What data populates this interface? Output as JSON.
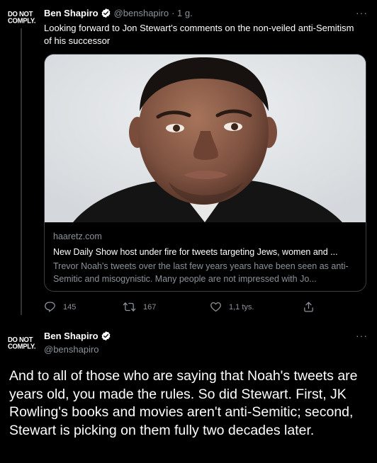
{
  "tweet1": {
    "avatar_text": [
      "DO NOT",
      "COMPLY."
    ],
    "author_name": "Ben Shapiro",
    "handle": "@benshapiro",
    "time": "· 1 g.",
    "more": "···",
    "text": "Looking forward to Jon Stewart's comments on the non-veiled anti-Semitism of his successor",
    "card": {
      "domain": "haaretz.com",
      "title": "New Daily Show host under fire for tweets targeting Jews, women and ...",
      "description": "Trevor Noah's tweets over the last few years years have been seen as anti-Semitic and misogynistic. Many people are not impressed with Jo..."
    },
    "actions": {
      "replies": "145",
      "retweets": "167",
      "likes": "1,1 tys."
    }
  },
  "tweet2": {
    "avatar_text": [
      "DO NOT",
      "COMPLY."
    ],
    "author_name": "Ben Shapiro",
    "handle": "@benshapiro",
    "more": "···",
    "text": "And to all of those who are saying that Noah's tweets are years old, you made the rules. So did Stewart. First, JK Rowling's books and movies aren't anti-Semitic; second, Stewart is picking on them fully two decades later."
  },
  "icons": [
    "verified-badge-icon",
    "more-icon",
    "reply-icon",
    "retweet-icon",
    "like-icon",
    "share-icon"
  ],
  "colors": {
    "background": "#000000",
    "text_primary": "#ffffff",
    "text_secondary": "#8b9299",
    "verified_badge": "#ffffff",
    "card_border": "#3a3f43"
  }
}
